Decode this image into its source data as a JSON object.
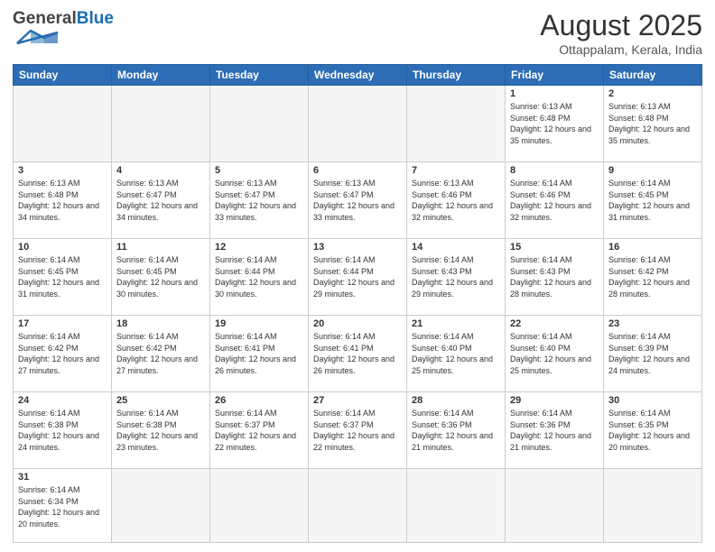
{
  "header": {
    "logo_general": "General",
    "logo_blue": "Blue",
    "month_year": "August 2025",
    "location": "Ottappalam, Kerala, India"
  },
  "days_of_week": [
    "Sunday",
    "Monday",
    "Tuesday",
    "Wednesday",
    "Thursday",
    "Friday",
    "Saturday"
  ],
  "weeks": [
    [
      {
        "day": "",
        "info": ""
      },
      {
        "day": "",
        "info": ""
      },
      {
        "day": "",
        "info": ""
      },
      {
        "day": "",
        "info": ""
      },
      {
        "day": "",
        "info": ""
      },
      {
        "day": "1",
        "info": "Sunrise: 6:13 AM\nSunset: 6:48 PM\nDaylight: 12 hours and 35 minutes."
      },
      {
        "day": "2",
        "info": "Sunrise: 6:13 AM\nSunset: 6:48 PM\nDaylight: 12 hours and 35 minutes."
      }
    ],
    [
      {
        "day": "3",
        "info": "Sunrise: 6:13 AM\nSunset: 6:48 PM\nDaylight: 12 hours and 34 minutes."
      },
      {
        "day": "4",
        "info": "Sunrise: 6:13 AM\nSunset: 6:47 PM\nDaylight: 12 hours and 34 minutes."
      },
      {
        "day": "5",
        "info": "Sunrise: 6:13 AM\nSunset: 6:47 PM\nDaylight: 12 hours and 33 minutes."
      },
      {
        "day": "6",
        "info": "Sunrise: 6:13 AM\nSunset: 6:47 PM\nDaylight: 12 hours and 33 minutes."
      },
      {
        "day": "7",
        "info": "Sunrise: 6:13 AM\nSunset: 6:46 PM\nDaylight: 12 hours and 32 minutes."
      },
      {
        "day": "8",
        "info": "Sunrise: 6:14 AM\nSunset: 6:46 PM\nDaylight: 12 hours and 32 minutes."
      },
      {
        "day": "9",
        "info": "Sunrise: 6:14 AM\nSunset: 6:45 PM\nDaylight: 12 hours and 31 minutes."
      }
    ],
    [
      {
        "day": "10",
        "info": "Sunrise: 6:14 AM\nSunset: 6:45 PM\nDaylight: 12 hours and 31 minutes."
      },
      {
        "day": "11",
        "info": "Sunrise: 6:14 AM\nSunset: 6:45 PM\nDaylight: 12 hours and 30 minutes."
      },
      {
        "day": "12",
        "info": "Sunrise: 6:14 AM\nSunset: 6:44 PM\nDaylight: 12 hours and 30 minutes."
      },
      {
        "day": "13",
        "info": "Sunrise: 6:14 AM\nSunset: 6:44 PM\nDaylight: 12 hours and 29 minutes."
      },
      {
        "day": "14",
        "info": "Sunrise: 6:14 AM\nSunset: 6:43 PM\nDaylight: 12 hours and 29 minutes."
      },
      {
        "day": "15",
        "info": "Sunrise: 6:14 AM\nSunset: 6:43 PM\nDaylight: 12 hours and 28 minutes."
      },
      {
        "day": "16",
        "info": "Sunrise: 6:14 AM\nSunset: 6:42 PM\nDaylight: 12 hours and 28 minutes."
      }
    ],
    [
      {
        "day": "17",
        "info": "Sunrise: 6:14 AM\nSunset: 6:42 PM\nDaylight: 12 hours and 27 minutes."
      },
      {
        "day": "18",
        "info": "Sunrise: 6:14 AM\nSunset: 6:42 PM\nDaylight: 12 hours and 27 minutes."
      },
      {
        "day": "19",
        "info": "Sunrise: 6:14 AM\nSunset: 6:41 PM\nDaylight: 12 hours and 26 minutes."
      },
      {
        "day": "20",
        "info": "Sunrise: 6:14 AM\nSunset: 6:41 PM\nDaylight: 12 hours and 26 minutes."
      },
      {
        "day": "21",
        "info": "Sunrise: 6:14 AM\nSunset: 6:40 PM\nDaylight: 12 hours and 25 minutes."
      },
      {
        "day": "22",
        "info": "Sunrise: 6:14 AM\nSunset: 6:40 PM\nDaylight: 12 hours and 25 minutes."
      },
      {
        "day": "23",
        "info": "Sunrise: 6:14 AM\nSunset: 6:39 PM\nDaylight: 12 hours and 24 minutes."
      }
    ],
    [
      {
        "day": "24",
        "info": "Sunrise: 6:14 AM\nSunset: 6:38 PM\nDaylight: 12 hours and 24 minutes."
      },
      {
        "day": "25",
        "info": "Sunrise: 6:14 AM\nSunset: 6:38 PM\nDaylight: 12 hours and 23 minutes."
      },
      {
        "day": "26",
        "info": "Sunrise: 6:14 AM\nSunset: 6:37 PM\nDaylight: 12 hours and 22 minutes."
      },
      {
        "day": "27",
        "info": "Sunrise: 6:14 AM\nSunset: 6:37 PM\nDaylight: 12 hours and 22 minutes."
      },
      {
        "day": "28",
        "info": "Sunrise: 6:14 AM\nSunset: 6:36 PM\nDaylight: 12 hours and 21 minutes."
      },
      {
        "day": "29",
        "info": "Sunrise: 6:14 AM\nSunset: 6:36 PM\nDaylight: 12 hours and 21 minutes."
      },
      {
        "day": "30",
        "info": "Sunrise: 6:14 AM\nSunset: 6:35 PM\nDaylight: 12 hours and 20 minutes."
      }
    ],
    [
      {
        "day": "31",
        "info": "Sunrise: 6:14 AM\nSunset: 6:34 PM\nDaylight: 12 hours and 20 minutes."
      },
      {
        "day": "",
        "info": ""
      },
      {
        "day": "",
        "info": ""
      },
      {
        "day": "",
        "info": ""
      },
      {
        "day": "",
        "info": ""
      },
      {
        "day": "",
        "info": ""
      },
      {
        "day": "",
        "info": ""
      }
    ]
  ]
}
